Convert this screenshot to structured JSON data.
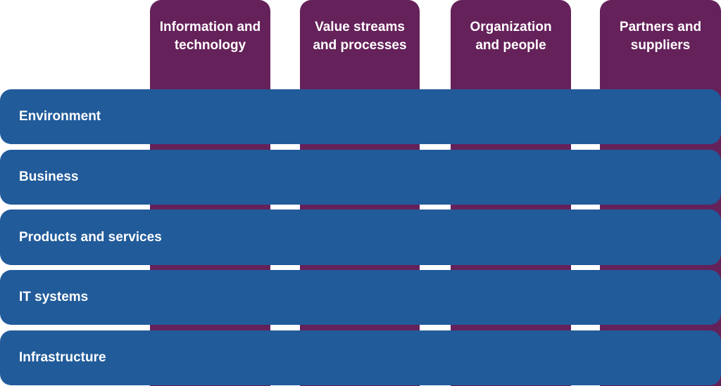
{
  "columns": [
    {
      "label": "Information and\ntechnology"
    },
    {
      "label": "Value streams\nand processes"
    },
    {
      "label": "Organization\nand people"
    },
    {
      "label": "Partners and\nsuppliers"
    }
  ],
  "rows": [
    {
      "label": "Environment"
    },
    {
      "label": "Business"
    },
    {
      "label": "Products and services"
    },
    {
      "label": "IT systems"
    },
    {
      "label": "Infrastructure"
    }
  ],
  "colors": {
    "column_fill": "#65215a",
    "row_fill": "#215b9a",
    "text": "#ffffff"
  }
}
